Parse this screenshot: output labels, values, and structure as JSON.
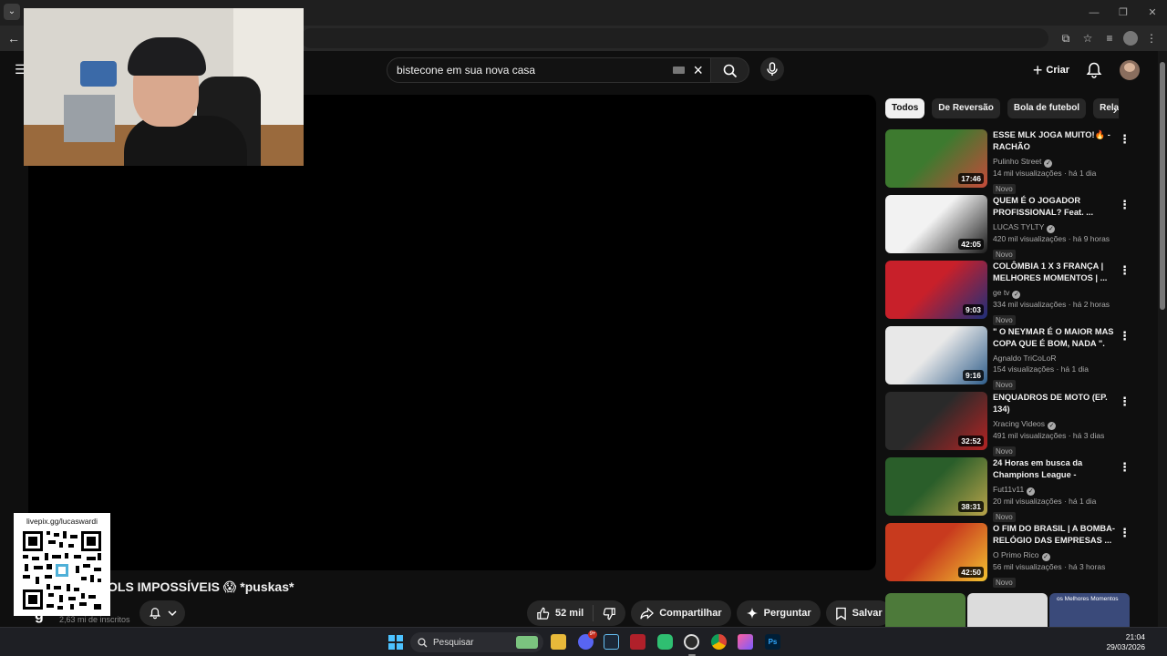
{
  "browser": {
    "tab_menu_icon": "chevron-down-icon",
    "window_controls": [
      "—",
      "❐",
      "✕"
    ]
  },
  "header": {
    "search_query": "bistecone em sua nova casa",
    "create_label": "Criar"
  },
  "video": {
    "title_fragment": "OLS IMPOSSÍVEIS 😱 *puskas*",
    "subscribers": "2,63 mi de inscritos",
    "like_count": "52 mil",
    "share_label": "Compartilhar",
    "ask_label": "Perguntar",
    "save_label": "Salvar"
  },
  "overlay": {
    "qr_url": "livepix.gg/lucaswardi"
  },
  "chips": [
    "Todos",
    "De Reversão",
    "Bola de futebol",
    "Relac"
  ],
  "recommendations": [
    {
      "title": "ESSE MLK JOGA MUITO!🔥 - RACHÃO",
      "channel": "Pulinho Street",
      "verified": true,
      "views": "14 mil visualizações",
      "age": "há 1 dia",
      "badge": "Novo",
      "duration": "17:46",
      "thumb_colors": [
        "#3d7a2f",
        "#c64a3a"
      ]
    },
    {
      "title": "QUEM É O JOGADOR PROFISSIONAL? Feat. ...",
      "channel": "LUCAS TYLTY",
      "verified": true,
      "views": "420 mil visualizações",
      "age": "há 9 horas",
      "badge": "Novo",
      "duration": "42:05",
      "thumb_colors": [
        "#f2f2f2",
        "#1a1a1a"
      ]
    },
    {
      "title": "COLÔMBIA 1 X 3 FRANÇA | MELHORES MOMENTOS | ...",
      "channel": "ge tv",
      "verified": true,
      "views": "334 mil visualizações",
      "age": "há 2 horas",
      "badge": "Novo",
      "duration": "9:03",
      "thumb_colors": [
        "#c8202a",
        "#1d2f7a"
      ]
    },
    {
      "title": "\" O NEYMAR É O MAIOR MAS COPA QUE É BOM, NADA \". PV...",
      "channel": "Agnaldo TriCoLoR",
      "verified": false,
      "views": "154 visualizações",
      "age": "há 1 dia",
      "badge": "Novo",
      "duration": "9:16",
      "thumb_colors": [
        "#e8e8e8",
        "#2f5d8a"
      ]
    },
    {
      "title": "ENQUADROS DE MOTO (EP. 134)",
      "channel": "Xracing Videos",
      "verified": true,
      "views": "491 mil visualizações",
      "age": "há 3 dias",
      "badge": "Novo",
      "duration": "32:52",
      "thumb_colors": [
        "#2a2a2a",
        "#b52323"
      ]
    },
    {
      "title": "24 Horas em busca da Champions League - Barcelon...",
      "channel": "Fut11v11",
      "verified": true,
      "views": "20 mil visualizações",
      "age": "há 1 dia",
      "badge": "Novo",
      "duration": "38:31",
      "thumb_colors": [
        "#2a5e2a",
        "#b9a34a"
      ]
    },
    {
      "title": "O FIM DO BRASIL | A BOMBA- RELÓGIO DAS EMPRESAS ...",
      "channel": "O Primo Rico",
      "verified": true,
      "views": "56 mil visualizações",
      "age": "há 3 horas",
      "badge": "Novo",
      "duration": "42:50",
      "thumb_colors": [
        "#c83a1e",
        "#f2c230"
      ]
    }
  ],
  "shorts_preview": [
    {
      "color": "#4d7a3a"
    },
    {
      "color": "#dcdcdc"
    },
    {
      "color": "#3a4a7a",
      "label": "os Melhores Momentos"
    }
  ],
  "taskbar": {
    "search_placeholder": "Pesquisar",
    "discord_badge": "9+",
    "time": "21:04",
    "date": "29/03/2026"
  }
}
